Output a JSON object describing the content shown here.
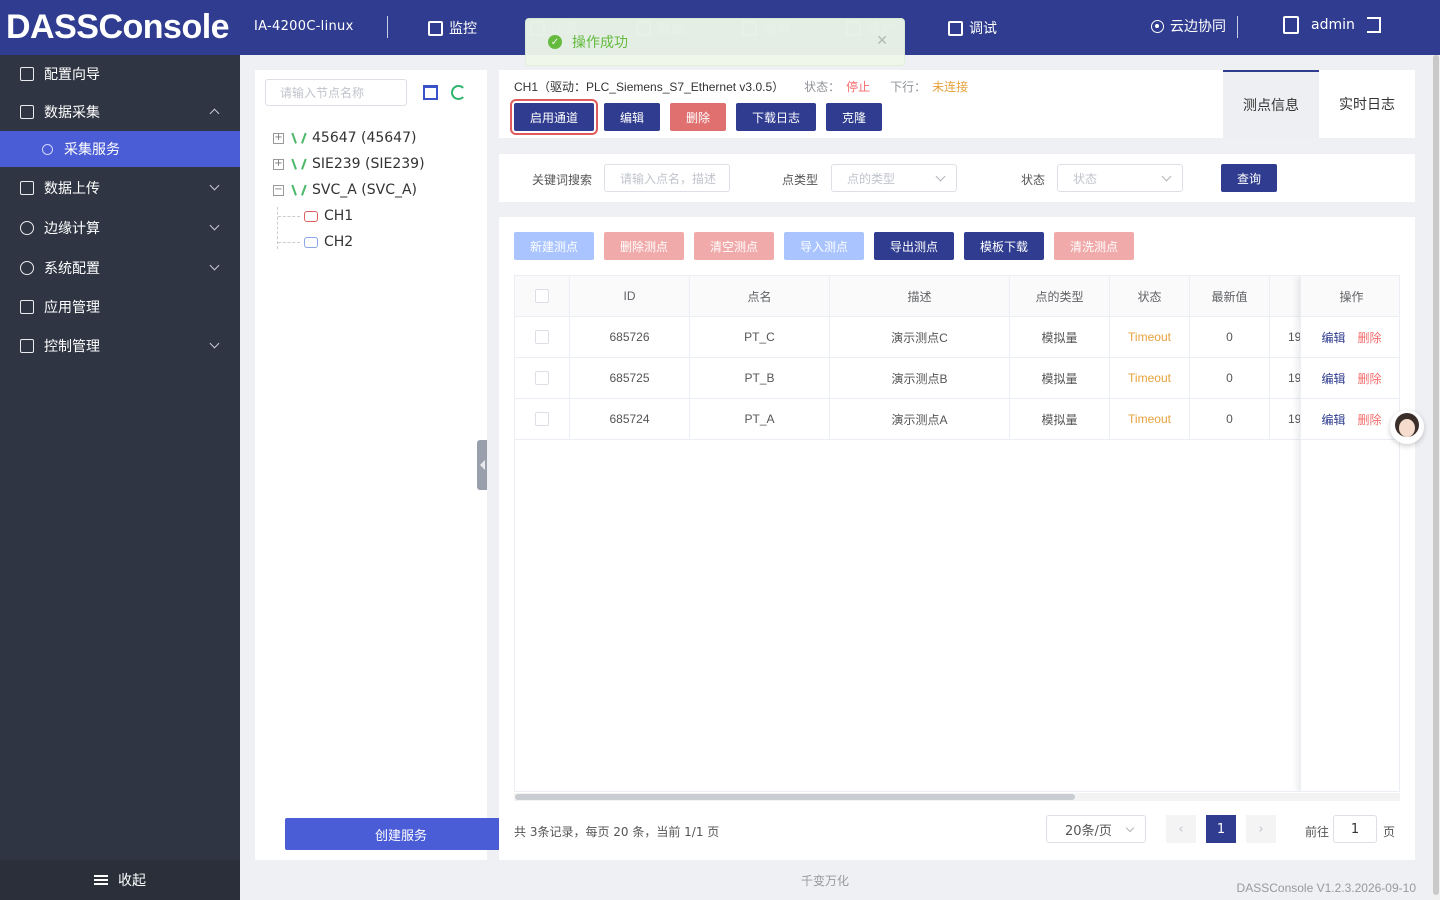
{
  "header": {
    "logo": "DASSConsole",
    "device": "IA-4200C-linux",
    "nav": [
      {
        "label": "监控",
        "icon": "monitor-icon"
      },
      {
        "label": "配置",
        "icon": "config-icon"
      },
      {
        "label": "数据",
        "icon": "data-icon"
      },
      {
        "label": "报警",
        "icon": "alarm-icon"
      },
      {
        "label": "维护",
        "icon": "maintain-icon"
      },
      {
        "label": "调试",
        "icon": "debug-icon"
      }
    ],
    "cloud": "云边协同",
    "user": "admin"
  },
  "toast": {
    "text": "操作成功"
  },
  "sidebar": {
    "items": [
      {
        "label": "配置向导"
      },
      {
        "label": "数据采集"
      },
      {
        "label": "采集服务"
      },
      {
        "label": "数据上传"
      },
      {
        "label": "边缘计算"
      },
      {
        "label": "系统配置"
      },
      {
        "label": "应用管理"
      },
      {
        "label": "控制管理"
      }
    ],
    "collapse": "收起"
  },
  "tree": {
    "search_placeholder": "请输入节点名称",
    "nodes": [
      {
        "label": "45647 (45647)"
      },
      {
        "label": "SIE239 (SIE239)"
      },
      {
        "label": "SVC_A (SVC_A)"
      },
      {
        "label": "CH1"
      },
      {
        "label": "CH2"
      }
    ],
    "create_button": "创建服务"
  },
  "channel": {
    "title": "CH1（驱动：PLC_Siemens_S7_Ethernet v3.0.5）",
    "status_label": "状态：",
    "status_value": "停止",
    "downlink_label": "下行：",
    "downlink_value": "未连接",
    "buttons": {
      "enable": "启用通道",
      "edit": "编辑",
      "delete": "删除",
      "download_log": "下载日志",
      "clone": "克隆"
    },
    "tabs": [
      "测点信息",
      "实时日志"
    ]
  },
  "filter": {
    "keyword_label": "关键词搜索",
    "keyword_placeholder": "请输入点名，描述",
    "type_label": "点类型",
    "type_placeholder": "点的类型",
    "status_label": "状态",
    "status_placeholder": "状态",
    "query": "查询"
  },
  "toolbar": {
    "new": "新建测点",
    "delete": "删除测点",
    "clear": "清空测点",
    "import": "导入测点",
    "export": "导出测点",
    "template": "模板下载",
    "wash": "清洗测点"
  },
  "table": {
    "columns": [
      "ID",
      "点名",
      "描述",
      "点的类型",
      "状态",
      "最新值",
      "操作"
    ],
    "rows": [
      {
        "id": "685726",
        "name": "PT_C",
        "desc": "演示测点C",
        "type": "模拟量",
        "status": "Timeout",
        "value": "0",
        "time": "19"
      },
      {
        "id": "685725",
        "name": "PT_B",
        "desc": "演示测点B",
        "type": "模拟量",
        "status": "Timeout",
        "value": "0",
        "time": "19"
      },
      {
        "id": "685724",
        "name": "PT_A",
        "desc": "演示测点A",
        "type": "模拟量",
        "status": "Timeout",
        "value": "0",
        "time": "19"
      }
    ],
    "op_edit": "编辑",
    "op_delete": "删除"
  },
  "pagination": {
    "summary": "共 3条记录，每页 20 条，当前 1/1 页",
    "page_size": "20条/页",
    "current": "1",
    "goto_label": "前往",
    "goto_value": "1",
    "page_unit": "页"
  },
  "footer": {
    "center": "千变万化",
    "version": "DASSConsole V1.2.3.2026-09-10"
  },
  "colors": {
    "brand": "#2f3c8f",
    "accent": "#4a5cd6",
    "sidebar": "#2f3542",
    "danger": "#f56c6c",
    "warning": "#e6a23c",
    "success": "#67c23a"
  }
}
